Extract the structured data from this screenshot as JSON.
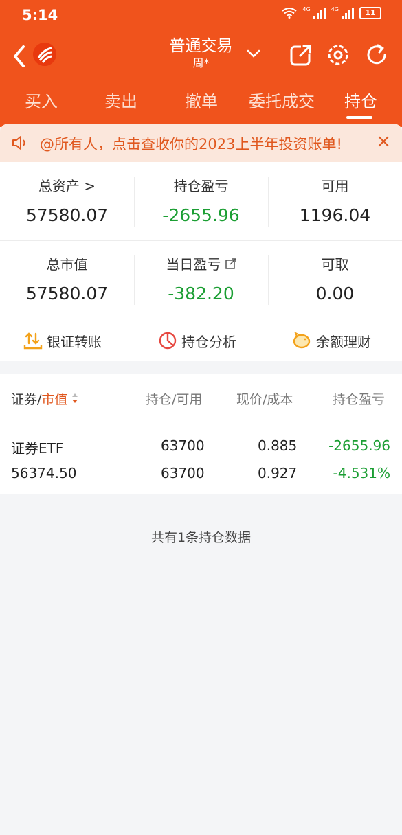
{
  "status_bar": {
    "time": "5:14",
    "net1": "4G",
    "net2": "4G",
    "battery": "11"
  },
  "nav": {
    "title": "普通交易",
    "subtitle": "周*"
  },
  "tabs": [
    {
      "label": "买入"
    },
    {
      "label": "卖出"
    },
    {
      "label": "撤单"
    },
    {
      "label": "委托成交"
    },
    {
      "label": "持仓"
    }
  ],
  "notice": {
    "text": "@所有人，点击查收你的2023上半年投资账单!",
    "close": "×"
  },
  "summary": {
    "total_assets_label": "总资产 >",
    "total_assets": "57580.07",
    "position_pnl_label": "持仓盈亏",
    "position_pnl": "-2655.96",
    "available_label": "可用",
    "available": "1196.04",
    "market_value_label": "总市值",
    "market_value": "57580.07",
    "daily_pnl_label": "当日盈亏",
    "daily_pnl": "-382.20",
    "withdrawable_label": "可取",
    "withdrawable": "0.00"
  },
  "quick_actions": {
    "bank_transfer": "银证转账",
    "position_analysis": "持仓分析",
    "wealth": "余额理财"
  },
  "table": {
    "header_security": "证券/",
    "header_market_value": "市值",
    "header_position": "持仓/可用",
    "header_price": "现价/成本",
    "header_pnl": "持仓盈亏",
    "rows": [
      {
        "name": "证券ETF",
        "market_value": "56374.50",
        "position": "63700",
        "available": "63700",
        "price": "0.885",
        "cost": "0.927",
        "pnl": "-2655.96",
        "pnl_pct": "-4.531%"
      }
    ]
  },
  "footer": {
    "note": "共有1条持仓数据"
  },
  "colors": {
    "brand": "#f0531c",
    "loss": "#1b9e33",
    "notice_text": "#e0581f"
  }
}
